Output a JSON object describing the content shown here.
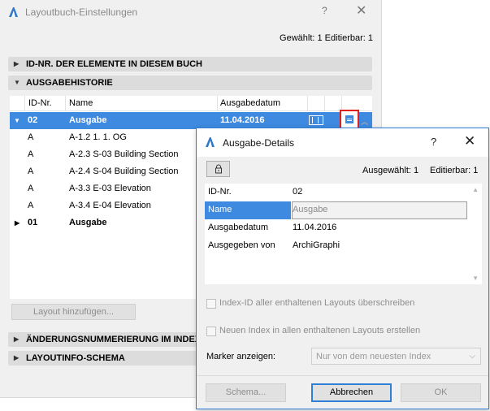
{
  "main_window": {
    "title": "Layoutbuch-Einstellungen",
    "help_glyph": "?",
    "close_glyph": "✕",
    "selection_info": "Gewählt: 1 Editierbar: 1",
    "sections": {
      "id_nr": "ID-NR. DER ELEMENTE IN DIESEM BUCH",
      "history": "AUSGABEHISTORIE",
      "change_numbering": "ÄNDERUNGSNUMMERIERUNG IM INDEX",
      "layoutinfo": "LAYOUTINFO-SCHEMA"
    },
    "table": {
      "headers": {
        "id": "ID-Nr.",
        "name": "Name",
        "date": "Ausgabedatum"
      },
      "rows": [
        {
          "id": "02",
          "name": "Ausgabe",
          "date": "11.04.2016",
          "expanded": true,
          "selected": true
        },
        {
          "id": "A",
          "name": "A-1.2 1. 1. OG"
        },
        {
          "id": "A",
          "name": "A-2.3 S-03 Building Section"
        },
        {
          "id": "A",
          "name": "A-2.4 S-04 Building Section"
        },
        {
          "id": "A",
          "name": "A-3.3 E-03 Elevation"
        },
        {
          "id": "A",
          "name": "A-3.4 E-04 Elevation"
        },
        {
          "id": "01",
          "name": "Ausgabe",
          "expanded": false
        }
      ]
    },
    "add_layout_button": "Layout hinzufügen..."
  },
  "dialog": {
    "title": "Ausgabe-Details",
    "help_glyph": "?",
    "close_glyph": "✕",
    "selected_info": "Ausgewählt: 1",
    "editable_info": "Editierbar: 1",
    "properties": [
      {
        "key": "ID-Nr.",
        "value": "02"
      },
      {
        "key": "Name",
        "value": "Ausgabe",
        "selected": true
      },
      {
        "key": "Ausgabedatum",
        "value": "11.04.2016"
      },
      {
        "key": "Ausgegeben von",
        "value": "ArchiGraphi"
      }
    ],
    "checkbox_override": "Index-ID aller enthaltenen Layouts überschreiben",
    "checkbox_new_index": "Neuen Index in allen enthaltenen Layouts erstellen",
    "marker_label": "Marker anzeigen:",
    "marker_value": "Nur von dem neuesten Index",
    "buttons": {
      "schema": "Schema...",
      "cancel": "Abbrechen",
      "ok": "OK"
    }
  },
  "colors": {
    "accent": "#3d8ae0",
    "highlight_border": "#e0201a",
    "dialog_border": "#2f7fd6"
  }
}
